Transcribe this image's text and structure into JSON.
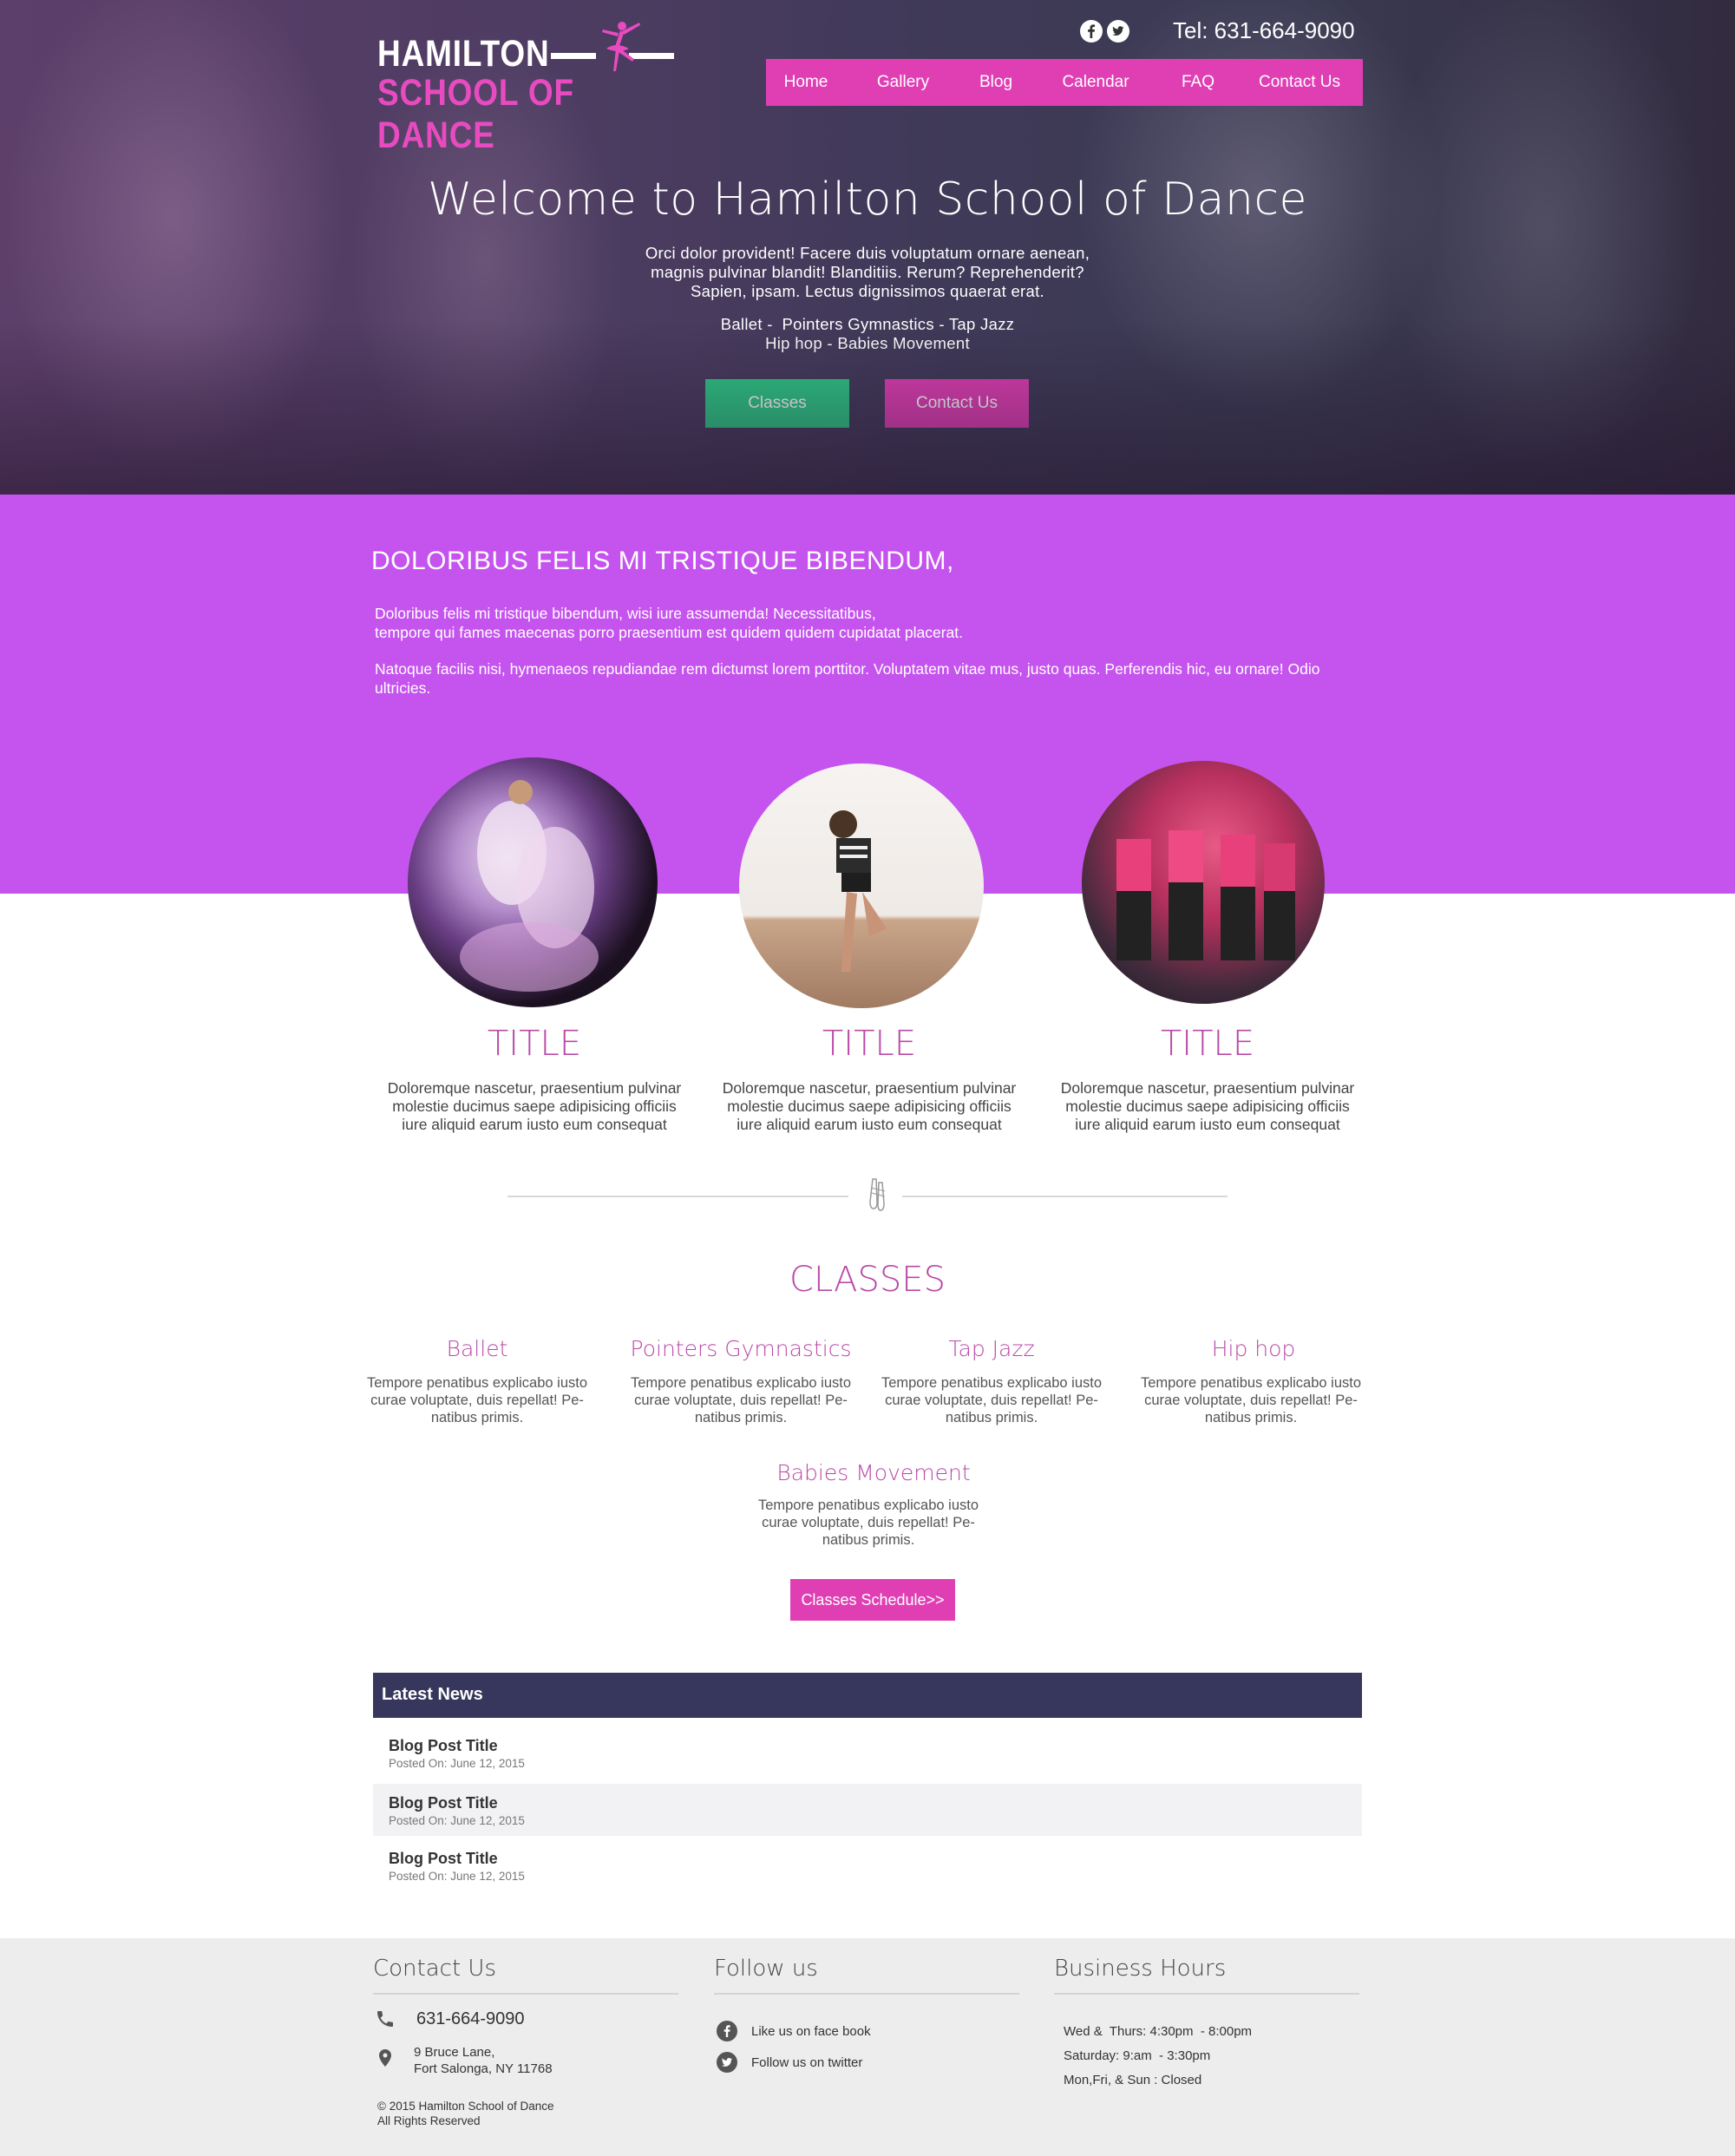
{
  "header": {
    "logo_line1": "HAMILTON",
    "logo_line2": "SCHOOL OF DANCE",
    "social": [
      "facebook-icon",
      "twitter-icon"
    ],
    "tel": "Tel: 631-664-9090"
  },
  "nav": {
    "items": [
      "Home",
      "Gallery",
      "Blog",
      "Calendar",
      "FAQ",
      "Contact Us"
    ]
  },
  "hero": {
    "title": "Welcome to Hamilton School of Dance",
    "text_lines": [
      "Orci dolor provident! Facere duis voluptatum ornare aenean,",
      "magnis pulvinar blandit! Blanditiis. Rerum? Reprehenderit?",
      "Sapien, ipsam. Lectus dignissimos quaerat erat."
    ],
    "list_lines": [
      "Ballet -  Pointers Gymnastics - Tap Jazz",
      "Hip hop - Babies Movement"
    ],
    "button_classes": "Classes",
    "button_contact": "Contact Us"
  },
  "intro": {
    "heading": "DOLORIBUS FELIS MI TRISTIQUE BIBENDUM,",
    "p1_line1": "Doloribus felis mi tristique bibendum, wisi iure assumenda! Necessitatibus,",
    "p1_line2": "tempore qui fames maecenas porro praesentium est quidem quidem cupidatat placerat.",
    "p2": "Natoque facilis nisi, hymenaeos repudiandae rem dictumst lorem porttitor. Voluptatem vitae mus, justo quas. Perferendis hic, eu ornare! Odio ultricies."
  },
  "features": [
    {
      "title": "TITLE",
      "lines": [
        "Doloremque nascetur, praesentium pulvinar",
        "molestie ducimus saepe adipisicing officiis",
        "iure aliquid earum iusto eum consequat"
      ]
    },
    {
      "title": "TITLE",
      "lines": [
        "Doloremque nascetur, praesentium pulvinar",
        "molestie ducimus saepe adipisicing officiis",
        "iure aliquid earum iusto eum consequat"
      ]
    },
    {
      "title": "TITLE",
      "lines": [
        "Doloremque nascetur, praesentium pulvinar",
        "molestie ducimus saepe adipisicing officiis",
        "iure aliquid earum iusto eum consequat"
      ]
    }
  ],
  "classes": {
    "heading": "CLASSES",
    "items": [
      {
        "title": "Ballet",
        "lines": [
          "Tempore penatibus explicabo iusto",
          "curae voluptate, duis repellat! Pe-",
          "natibus primis."
        ]
      },
      {
        "title": "Pointers Gymnastics",
        "lines": [
          "Tempore penatibus explicabo iusto",
          "curae voluptate, duis repellat! Pe-",
          "natibus primis."
        ]
      },
      {
        "title": "Tap Jazz",
        "lines": [
          "Tempore penatibus explicabo iusto",
          "curae voluptate, duis repellat! Pe-",
          "natibus primis."
        ]
      },
      {
        "title": "Hip hop",
        "lines": [
          "Tempore penatibus explicabo iusto",
          "curae voluptate, duis repellat! Pe-",
          "natibus primis."
        ]
      },
      {
        "title": "Babies Movement",
        "lines": [
          "Tempore penatibus explicabo iusto",
          "curae voluptate, duis repellat! Pe-",
          "natibus primis."
        ]
      }
    ],
    "schedule_button": "Classes Schedule>>"
  },
  "news": {
    "heading": "Latest News",
    "posts": [
      {
        "title": "Blog Post Title",
        "date": "Posted On: June 12, 2015"
      },
      {
        "title": "Blog Post Title",
        "date": "Posted On: June 12, 2015"
      },
      {
        "title": "Blog Post Title",
        "date": "Posted On: June 12, 2015"
      }
    ]
  },
  "footer": {
    "contact_heading": "Contact Us",
    "phone": "631-664-9090",
    "address_line1": "9 Bruce Lane,",
    "address_line2": "Fort Salonga, NY 11768",
    "copyright_line1": "© 2015 Hamilton School of Dance",
    "copyright_line2": "All Rights Reserved",
    "follow_heading": "Follow us",
    "facebook_text": "Like us on face book",
    "twitter_text": "Follow us on twitter",
    "hours_heading": "Business Hours",
    "hours": [
      "Wed &  Thurs: 4:30pm  - 8:00pm",
      "Saturday: 9:am  - 3:30pm",
      "Mon,Fri, & Sun : Closed"
    ]
  },
  "colors": {
    "accent_pink": "#e03fb4",
    "accent_purple": "#c553ee",
    "title_magenta": "#b94aa8",
    "green": "#2dca86",
    "navy": "#37375e"
  }
}
